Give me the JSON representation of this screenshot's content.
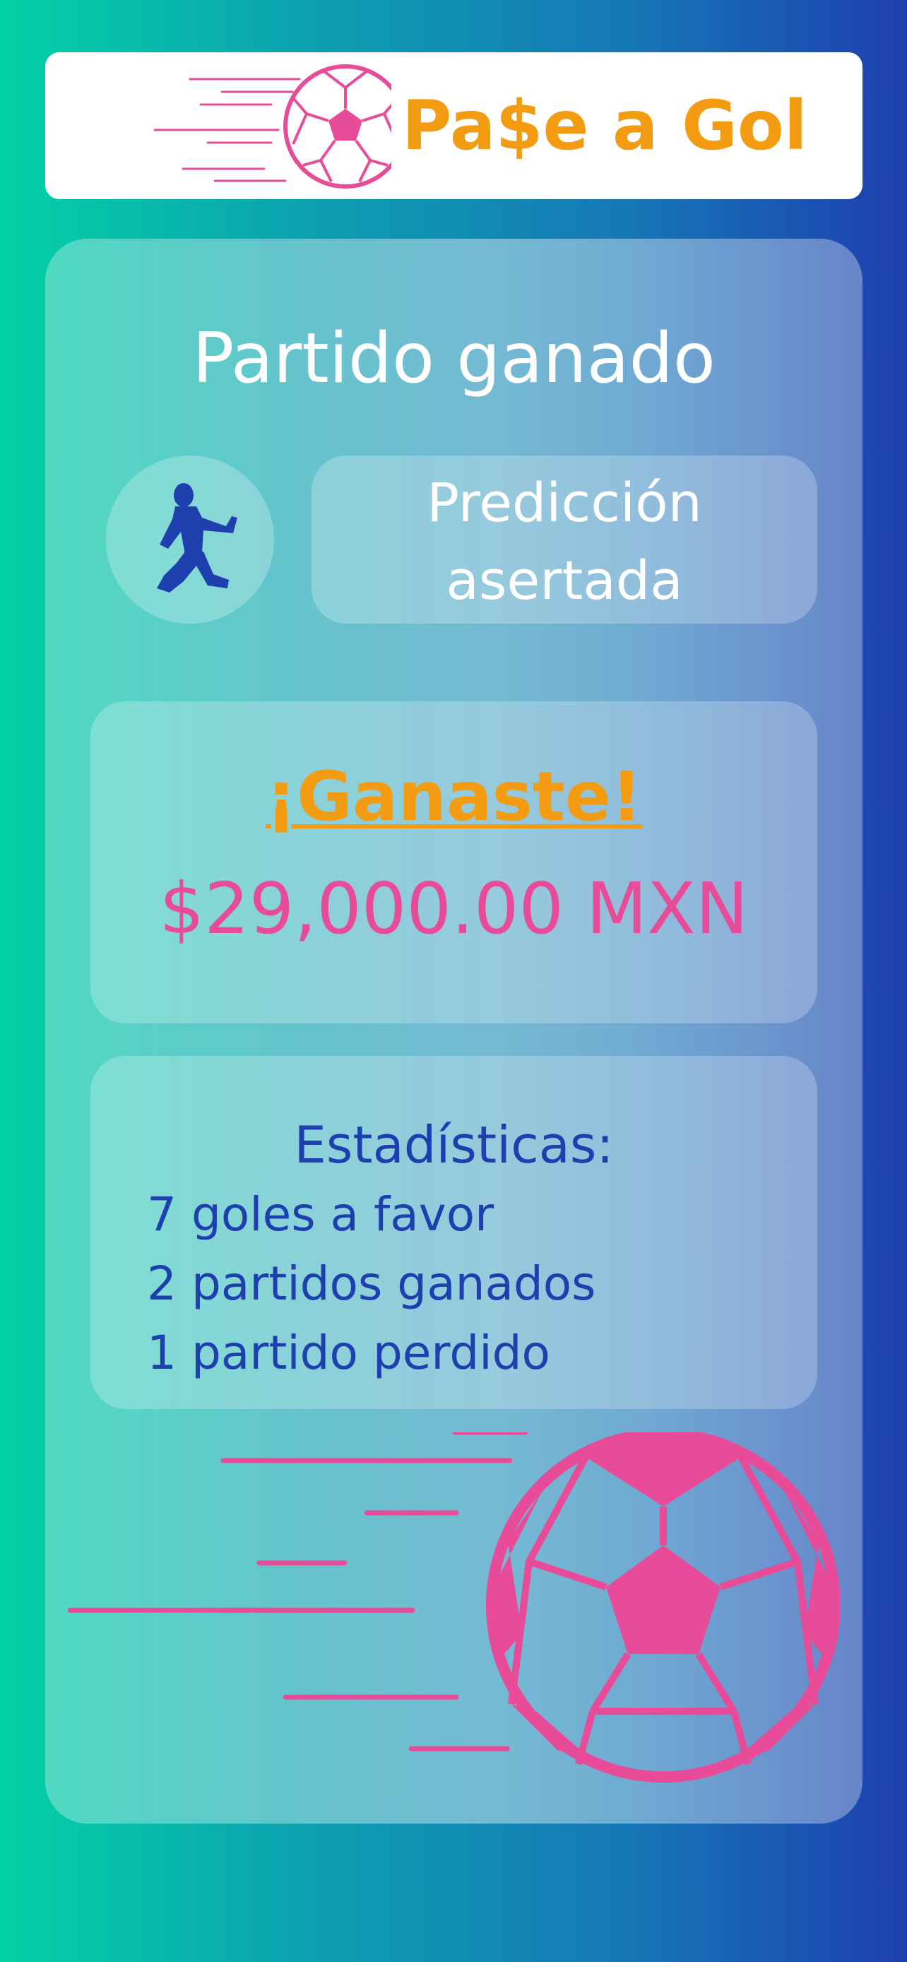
{
  "brand": {
    "name": "Pa$e a Gol",
    "logo_icon": "soccer-ball-icon"
  },
  "result": {
    "title": "Partido ganado",
    "player_icon": "celebrating-player-icon",
    "prediction_line1": "Predicción",
    "prediction_line2": "asertada"
  },
  "prize": {
    "title": "¡Ganaste!",
    "amount": "$29,000.00 MXN"
  },
  "stats": {
    "title": "Estadísticas:",
    "lines": [
      "7 goles a favor",
      "2 partidos ganados",
      "1 partido perdido"
    ]
  },
  "colors": {
    "accent_orange": "#f39c12",
    "accent_pink": "#e84b98",
    "text_blue": "#1e40af",
    "gradient_start": "#03d1a6",
    "gradient_end": "#1e3fb0"
  },
  "decoration": {
    "icon": "soccer-ball-icon"
  }
}
